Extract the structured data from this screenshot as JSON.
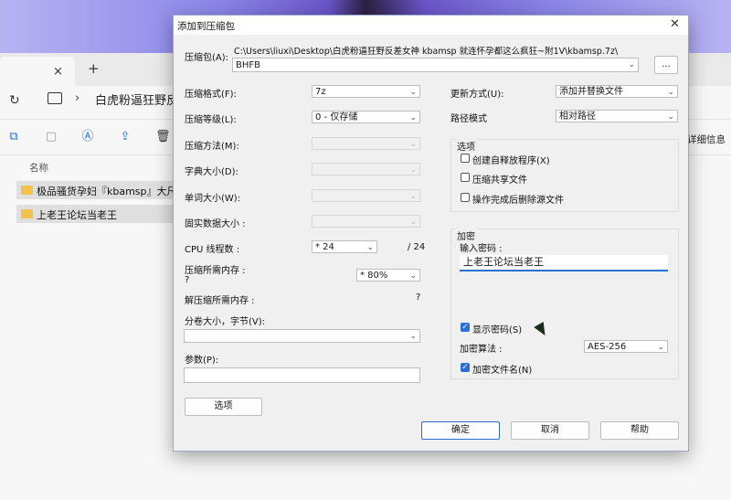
{
  "explorer": {
    "tab_close": "×",
    "new_tab": "+",
    "refresh": "↻",
    "chevron": "›",
    "path": "白虎粉逼狂野反",
    "details_label": "详细信息",
    "column_name": "名称",
    "rows": [
      {
        "name": "极品骚货孕妇『kbamsp』大尺度"
      },
      {
        "name": "上老王论坛当老王"
      }
    ]
  },
  "dialog": {
    "title": "添加到压缩包",
    "close": "✕",
    "archive_label": "压缩包(A):",
    "archive_path": "C:\\Users\\liuxi\\Desktop\\白虎粉逼狂野反差女神 kbamsp 就连怀孕都这么疯狂~附1V\\kbamsp.7z\\",
    "archive_name": "BHFB",
    "browse": "...",
    "left": {
      "format_label": "压缩格式(F):",
      "format_value": "7z",
      "level_label": "压缩等级(L):",
      "level_value": "0 - 仅存储",
      "method_label": "压缩方法(M):",
      "dict_label": "字典大小(D):",
      "word_label": "单词大小(W):",
      "solid_label": "固实数据大小 :",
      "cpu_label": "CPU 线程数 :",
      "cpu_value": "* 24",
      "cpu_total": "/ 24",
      "mem_label": "压缩所需内存 :",
      "mem_q": "?",
      "mem_value": "* 80%",
      "dmem_label": "解压缩所需内存 :",
      "dmem_q": "?",
      "split_label": "分卷大小，字节(V):",
      "params_label": "参数(P):",
      "options_btn": "选项"
    },
    "right": {
      "update_label": "更新方式(U):",
      "update_value": "添加并替换文件",
      "pathmode_label": "路径模式",
      "pathmode_value": "相对路径",
      "options_title": "选项",
      "opt_sfx": "创建自释放程序(X)",
      "opt_shared": "压缩共享文件",
      "opt_delete": "操作完成后删除源文件",
      "enc_title": "加密",
      "pw_label": "输入密码 :",
      "pw_value": "上老王论坛当老王",
      "show_pw": "显示密码(S)",
      "algo_label": "加密算法 :",
      "algo_value": "AES-256",
      "enc_names": "加密文件名(N)",
      "check": "✓"
    },
    "ok": "确定",
    "cancel": "取消",
    "help": "帮助"
  },
  "arrow": "⌄"
}
